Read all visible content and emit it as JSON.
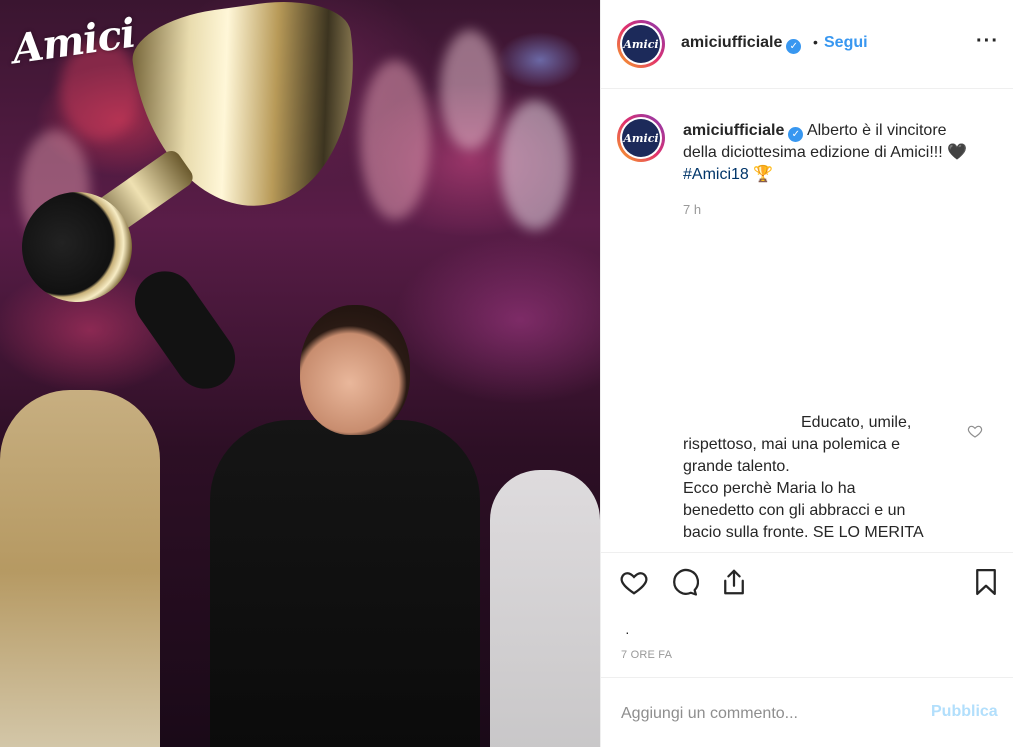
{
  "brand": {
    "logo_text": "Amici",
    "avatar_text": "Amici"
  },
  "post": {
    "username": "amiciufficiale",
    "separator": "•",
    "follow_label": "Segui",
    "more_icon": "more-horizontal-icon",
    "caption": {
      "username": "amiciufficiale",
      "text": "Alberto è il vincitore della diciottesima edizione di Amici!!!",
      "heart": "🖤",
      "hashtag": "#Amici18",
      "trophy": "🏆",
      "time": "7 h"
    },
    "comment": {
      "line1": "Educato, umile,",
      "line2": "rispettoso, mai una polemica e",
      "line3": "grande talento.",
      "line4": "Ecco perchè Maria lo ha",
      "line5": "benedetto con gli abbracci e un",
      "line6": "bacio sulla fronte. SE LO MERITA"
    },
    "actions": [
      "like-icon",
      "comment-icon",
      "share-icon",
      "save-icon"
    ],
    "likers_hint": "·",
    "date_label": "7 ORE FA"
  },
  "composer": {
    "placeholder": "Aggiungi un commento...",
    "publish_label": "Pubblica"
  },
  "colors": {
    "accent": "#3897f0",
    "publish_disabled": "#b2dffc",
    "hashtag": "#003569"
  }
}
